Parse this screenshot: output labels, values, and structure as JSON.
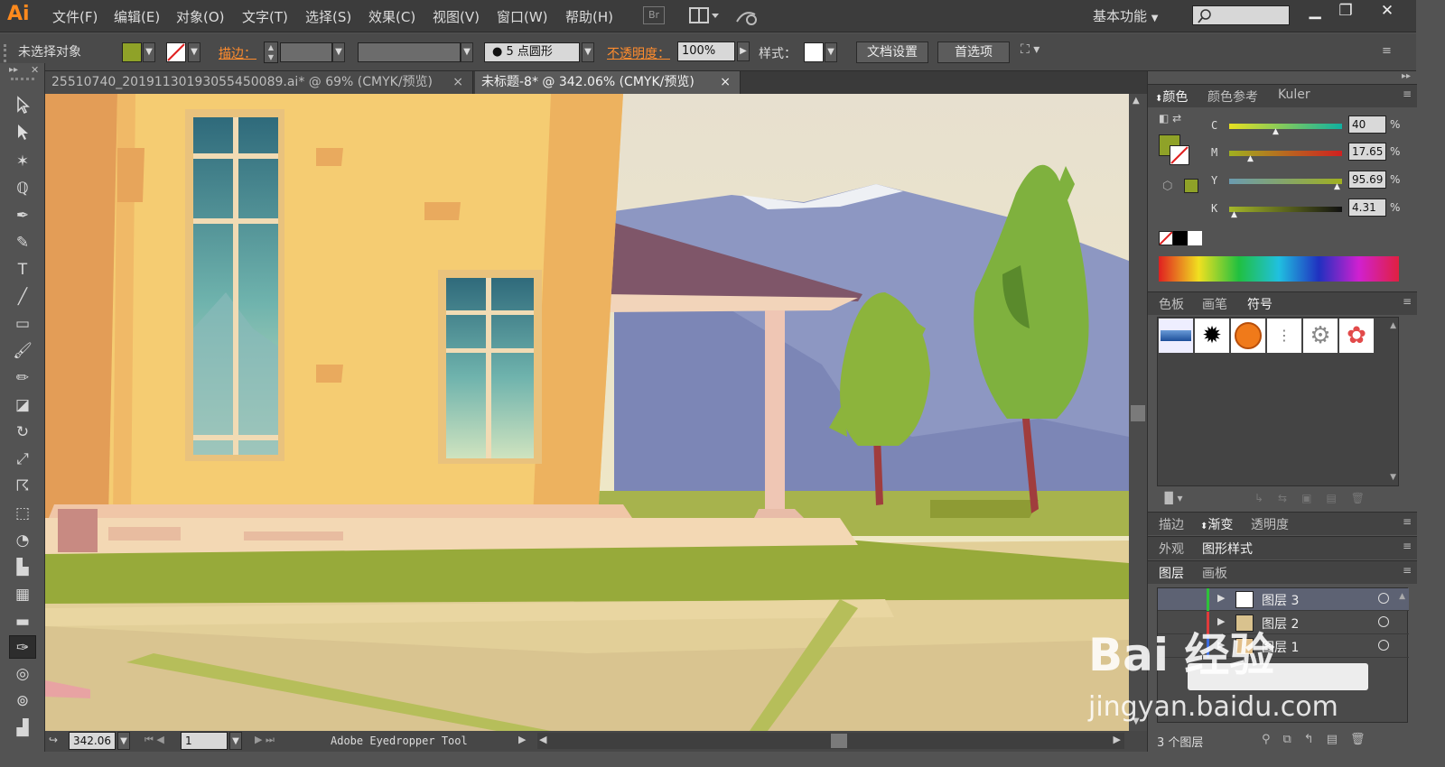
{
  "app": {
    "logo": "Ai"
  },
  "menu": [
    "文件(F)",
    "编辑(E)",
    "对象(O)",
    "文字(T)",
    "选择(S)",
    "效果(C)",
    "视图(V)",
    "窗口(W)",
    "帮助(H)"
  ],
  "menubar": {
    "bridge": "Br",
    "workspace": "基本功能"
  },
  "controlbar": {
    "selection": "未选择对象",
    "fill_color": "#8fa228",
    "stroke_label": "描边：",
    "brush": "5 点圆形",
    "opacity_label": "不透明度：",
    "opacity_value": "100%",
    "style_label": "样式：",
    "doc_setup": "文档设置",
    "prefs": "首选项"
  },
  "tabs": [
    {
      "label": "25510740_20191130193055450089.ai* @ 69% (CMYK/预览)",
      "active": false
    },
    {
      "label": "未标题-8* @ 342.06% (CMYK/预览)",
      "active": true
    }
  ],
  "tab_close": "×",
  "status": {
    "zoom": "342.06",
    "page": "1",
    "tool_name": "Adobe Eyedropper Tool"
  },
  "color_panel": {
    "tabs": [
      "颜色",
      "颜色参考",
      "Kuler"
    ],
    "channels": [
      {
        "name": "C",
        "value": "40",
        "pos": 0.4
      },
      {
        "name": "M",
        "value": "17.65",
        "pos": 0.18
      },
      {
        "name": "Y",
        "value": "95.69",
        "pos": 0.96
      },
      {
        "name": "K",
        "value": "4.31",
        "pos": 0.04
      }
    ],
    "unit": "%"
  },
  "symbols_panel": {
    "tabs": [
      "色板",
      "画笔",
      "符号"
    ]
  },
  "gradient_panel": {
    "tabs": [
      "描边",
      "渐变",
      "透明度"
    ]
  },
  "appearance_panel": {
    "tabs": [
      "外观",
      "图形样式"
    ]
  },
  "layers_panel": {
    "tabs": [
      "图层",
      "画板"
    ],
    "layers": [
      {
        "name": "图层 3",
        "selected": true
      },
      {
        "name": "图层 2",
        "selected": false
      },
      {
        "name": "图层 1",
        "selected": false
      }
    ],
    "count": "3 个图层"
  },
  "watermark": {
    "brand": "Bai 经验",
    "url": "jingyan.baidu.com"
  }
}
